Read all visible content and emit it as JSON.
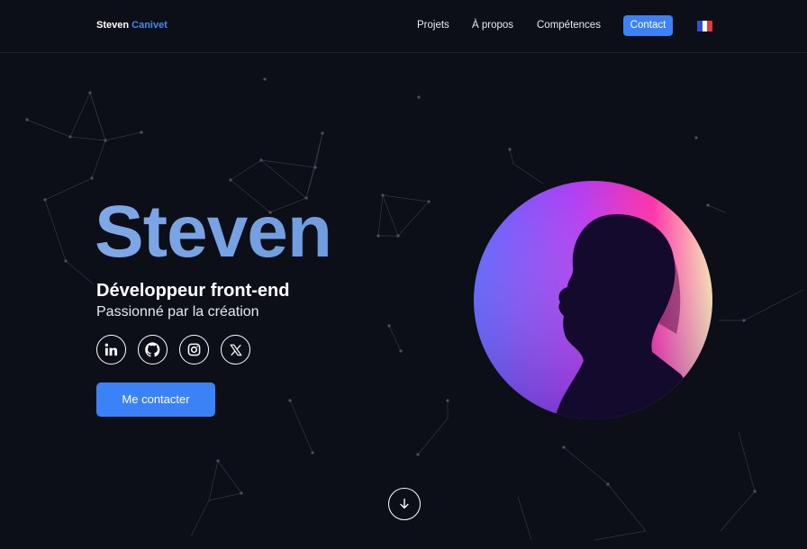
{
  "nav": {
    "brand_first": "Steven",
    "brand_last": "Canivet",
    "links": [
      "Projets",
      "À propos",
      "Compétences"
    ],
    "contact_label": "Contact",
    "language_icon": "france-flag-icon"
  },
  "hero": {
    "name": "Steven",
    "role": "Développeur front-end",
    "tagline": "Passionné par la création",
    "cta_label": "Me contacter",
    "socials": [
      "linkedin-icon",
      "github-icon",
      "instagram-icon",
      "x-icon"
    ],
    "scroll_icon": "arrow-down-icon"
  },
  "colors": {
    "background": "#0c0f17",
    "accent": "#3b82f6",
    "name_gradient": "#7fa8e6",
    "text": "#ffffff"
  }
}
